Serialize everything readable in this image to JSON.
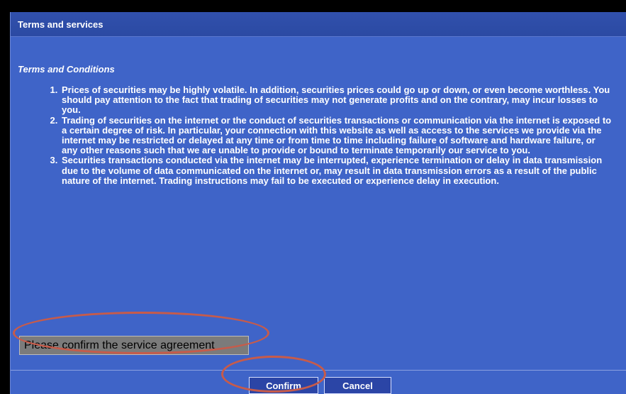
{
  "dialog": {
    "title": "Terms and services",
    "subtitle": "Terms and Conditions",
    "terms": [
      "Prices of securities may be highly volatile. In addition, securities prices could go up or down, or even become worthless. You should pay attention to the fact that trading of securities may not generate profits and on the contrary, may incur losses to you.",
      "Trading of securities on the internet or the conduct of securities transactions or communication via the internet is exposed to a certain degree of risk. In particular, your connection with this website as well as access to the services we provide via the internet may be restricted or delayed at any time or from time to time including failure of software and hardware failure, or any other reasons such that we are unable to provide or bound to terminate temporarily our service to you.",
      "Securities transactions conducted via the internet may be interrupted, experience termination or delay in data transmission due to the volume of data communicated on the internet or, may result in data transmission errors as a result of the public nature of the internet. Trading instructions may fail to be executed or experience delay in execution."
    ],
    "confirm_agreement_label": "Please confirm the service agreement",
    "buttons": {
      "confirm": "Confirm",
      "cancel": "Cancel"
    }
  },
  "colors": {
    "dialog_bg": "#3f64c8",
    "titlebar_bg": "#2b4aa3",
    "annotation": "#c75b4a"
  }
}
